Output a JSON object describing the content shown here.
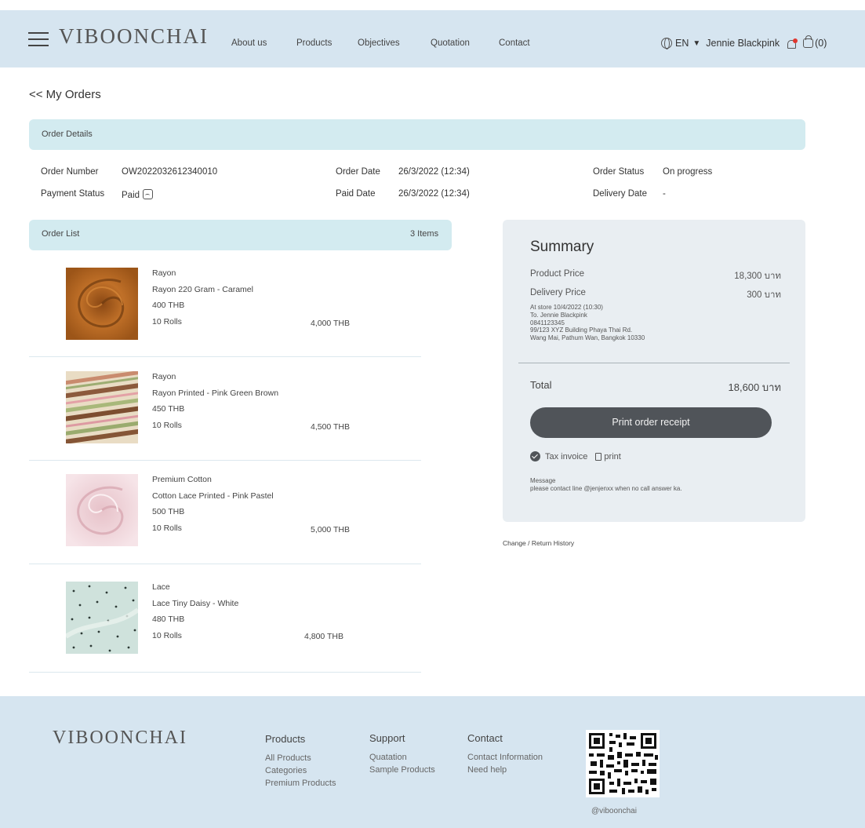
{
  "header": {
    "logo": "VIBOONCHAI",
    "nav": [
      "About us",
      "Products",
      "Objectives",
      "Quotation",
      "Contact"
    ],
    "language": "EN",
    "user": "Jennie Blackpink",
    "cart_count": "(0)"
  },
  "page": {
    "back_link": "<< My Orders"
  },
  "order_details": {
    "section_title": "Order Details",
    "order_number_label": "Order Number",
    "order_number": "OW2022032612340010",
    "payment_status_label": "Payment Status",
    "payment_status": "Paid",
    "order_date_label": "Order Date",
    "order_date": "26/3/2022 (12:34)",
    "paid_date_label": "Paid Date",
    "paid_date": "26/3/2022 (12:34)",
    "order_status_label": "Order Status",
    "order_status": "On progress",
    "delivery_date_label": "Delivery Date",
    "delivery_date": "-"
  },
  "order_list": {
    "section_title": "Order List",
    "count": "3 Items",
    "items": [
      {
        "category": "Rayon",
        "name": "Rayon 220 Gram - Caramel",
        "unit_price": "400 THB",
        "qty": "10 Rolls",
        "subtotal": "4,000 THB",
        "swatch": "caramel"
      },
      {
        "category": "Rayon",
        "name": "Rayon Printed - Pink Green Brown",
        "unit_price": "450 THB",
        "qty": "10 Rolls",
        "subtotal": "4,500 THB",
        "swatch": "striped"
      },
      {
        "category": "Premium Cotton",
        "name": "Cotton Lace Printed - Pink Pastel",
        "unit_price": "500 THB",
        "qty": "10 Rolls",
        "subtotal": "5,000 THB",
        "swatch": "pink-pastel"
      },
      {
        "category": "Lace",
        "name": "Lace Tiny Daisy - White",
        "unit_price": "480 THB",
        "qty": "10 Rolls",
        "subtotal": "4,800 THB",
        "swatch": "mint-dotted"
      }
    ]
  },
  "summary": {
    "title": "Summary",
    "product_price_label": "Product Price",
    "product_price": "18,300 บาท",
    "delivery_price_label": "Delivery Price",
    "delivery_price": "300 บาท",
    "address_lines": [
      "At store 10/4/2022 (10:30)",
      "To. Jennie Blackpink",
      "0841123345",
      "99/123 XYZ Building Phaya Thai Rd.",
      "Wang Mai, Pathum Wan, Bangkok 10330"
    ],
    "total_label": "Total",
    "total": "18,600 บาท",
    "print_button": "Print order receipt",
    "tax_invoice": "Tax invoice",
    "print_link": "print",
    "message_label": "Message",
    "message": "please contact line @jenjenxx when no call answer ka."
  },
  "return_link": "Change / Return History",
  "footer": {
    "logo": "VIBOONCHAI",
    "products": {
      "title": "Products",
      "links": [
        "All Products",
        "Categories",
        "Premium Products"
      ]
    },
    "support": {
      "title": "Support",
      "links": [
        "Quatation",
        "Sample Products"
      ]
    },
    "contact": {
      "title": "Contact",
      "links": [
        "Contact Information",
        "Need help"
      ]
    },
    "qr_handle": "@viboonchai"
  },
  "colors": {
    "header_bg": "#d6e5f0",
    "section_bar": "#d3ebf0",
    "summary_bg": "#e9eef2",
    "button": "#505459",
    "notification_dot": "#e0362f"
  }
}
